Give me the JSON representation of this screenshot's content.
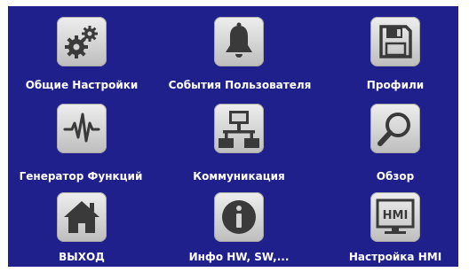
{
  "menu": {
    "row1": [
      {
        "label": "Общие Настройки",
        "icon": "gears-icon"
      },
      {
        "label": "События Пользователя",
        "icon": "bell-icon"
      },
      {
        "label": "Профили",
        "icon": "floppy-disk-icon"
      }
    ],
    "row2": [
      {
        "label": "Генератор Функций",
        "icon": "waveform-icon"
      },
      {
        "label": "Коммуникация",
        "icon": "network-icon"
      },
      {
        "label": "Обзор",
        "icon": "magnifier-icon"
      }
    ],
    "row3": [
      {
        "label": "ВЫХОД",
        "icon": "home-icon"
      },
      {
        "label": "Инфо HW, SW,...",
        "icon": "info-icon"
      },
      {
        "label": "Настройка HMI",
        "icon": "hmi-icon"
      }
    ]
  },
  "hmi_icon_text": "HMI",
  "colors": {
    "background": "#1f208c",
    "icon_tile": "#d4d4d4",
    "icon_glyph": "#3a3a3a",
    "label_text": "#ffffff"
  }
}
